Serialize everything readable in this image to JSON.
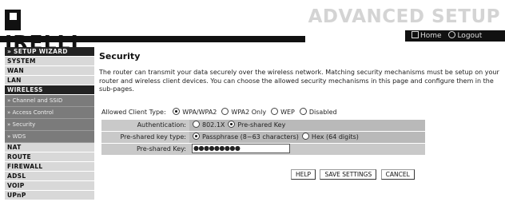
{
  "header": {
    "brand": "IRELLI",
    "title": "ADVANCED SETUP",
    "home_label": "Home",
    "logout_label": "Logout"
  },
  "sidebar": {
    "items": [
      {
        "label": "» SETUP WIZARD",
        "dark": true
      },
      {
        "label": "SYSTEM"
      },
      {
        "label": "WAN"
      },
      {
        "label": "LAN"
      },
      {
        "label": "WIRELESS",
        "dark": true
      },
      {
        "label": "» Channel and SSID",
        "sub": true
      },
      {
        "label": "» Access Control",
        "sub": true
      },
      {
        "label": "» Security",
        "sub": true
      },
      {
        "label": "» WDS",
        "sub": true
      },
      {
        "label": "NAT"
      },
      {
        "label": "ROUTE"
      },
      {
        "label": "FIREWALL"
      },
      {
        "label": "ADSL"
      },
      {
        "label": "VOIP"
      },
      {
        "label": "UPnP"
      }
    ]
  },
  "main": {
    "title": "Security",
    "description": "The router can transmit your data securely over the wireless network. Matching security mechanisms must be setup on your router and wireless client devices. You can choose the allowed security mechanisms in this page and configure them in the sub-pages.",
    "client_type_label": "Allowed Client Type:",
    "client_options": [
      "WPA/WPA2",
      "WPA2 Only",
      "WEP",
      "Disabled"
    ],
    "client_selected": "WPA/WPA2",
    "auth_label": "Authentication:",
    "auth_options": [
      "802.1X",
      "Pre-shared Key"
    ],
    "auth_selected": "Pre-shared Key",
    "psk_type_label": "Pre-shared key type:",
    "psk_type_options": [
      "Passphrase (8~63 characters)",
      "Hex (64 digits)"
    ],
    "psk_type_selected": "Passphrase (8~63 characters)",
    "psk_label": "Pre-shared Key:",
    "psk_value": "●●●●●●●●●",
    "buttons": {
      "help": "HELP",
      "save": "SAVE SETTINGS",
      "cancel": "CANCEL"
    }
  }
}
